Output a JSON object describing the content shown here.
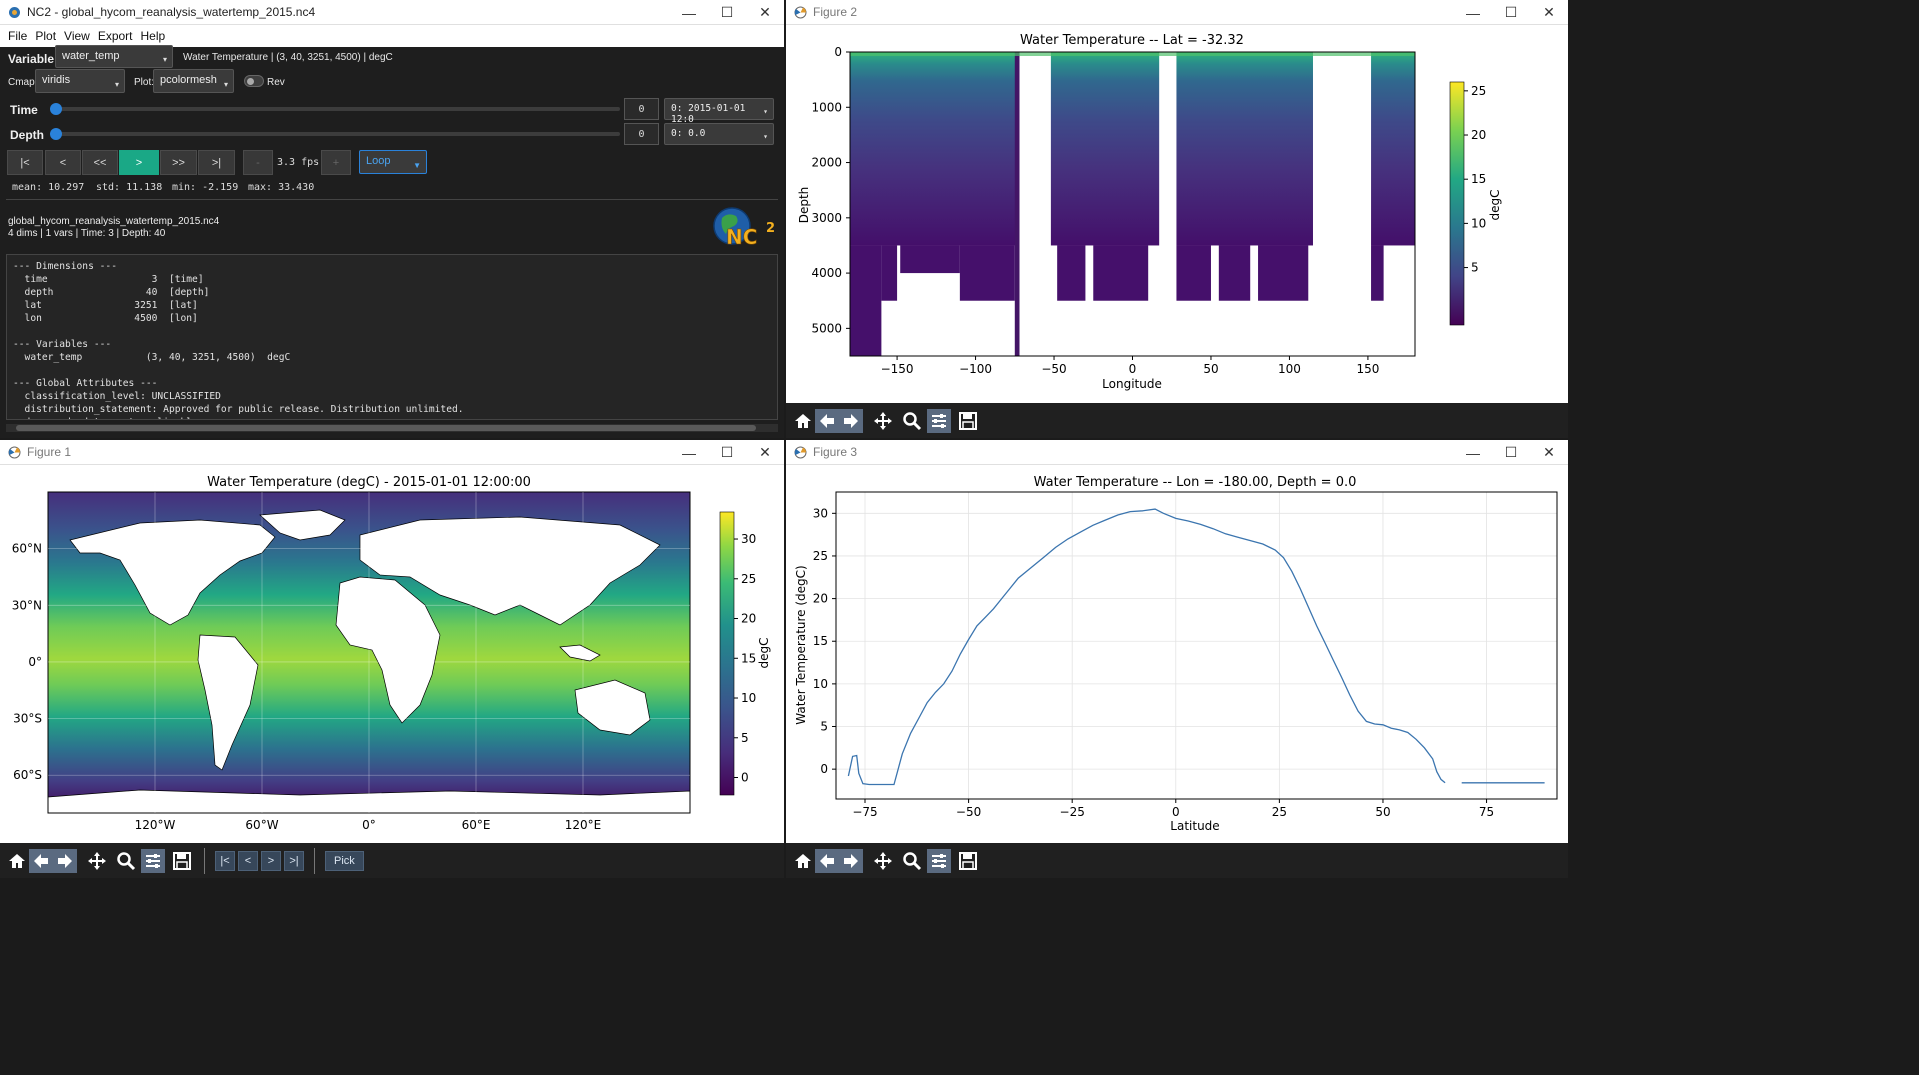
{
  "nc2": {
    "title": "NC2 - global_hycom_reanalysis_watertemp_2015.nc4",
    "menu": [
      "File",
      "Plot",
      "View",
      "Export",
      "Help"
    ],
    "variable_label": "Variable:",
    "variable_value": "water_temp",
    "variable_desc": "Water Temperature | (3, 40, 3251, 4500) | degC",
    "cmap_label": "Cmap:",
    "cmap_value": "viridis",
    "plot_label": "Plot:",
    "plot_value": "pcolormesh",
    "rev_label": "Rev",
    "time_label": "Time",
    "time_index": "0",
    "time_value": "0: 2015-01-01 12:0",
    "depth_label": "Depth",
    "depth_index": "0",
    "depth_value": "0: 0.0",
    "buttons": {
      "first": "|<",
      "prev": "<",
      "rew": "<<",
      "play": ">",
      "ff": ">>",
      "last": ">|",
      "minus": "-",
      "fps": "3.3 fps",
      "plus": "+",
      "loop": "Loop"
    },
    "stats": {
      "mean": "mean: 10.297",
      "std": "std: 11.138",
      "min": "min: -2.159",
      "max": "max: 33.430"
    },
    "file_name": "global_hycom_reanalysis_watertemp_2015.nc4",
    "file_summary": "4 dims | 1 vars | Time: 3 | Depth: 40",
    "logo_text": "NC",
    "info_text": "--- Dimensions ---\n  time                  3  [time]\n  depth                40  [depth]\n  lat                3251  [lat]\n  lon                4500  [lon]\n\n--- Variables ---\n  water_temp           (3, 40, 3251, 4500)  degC\n\n--- Global Attributes ---\n  classification_level: UNCLASSIFIED\n  distribution_statement: Approved for public release. Distribution unlimited.\n  downgrade_date: not applicable\n  classification_authority: not applicable\n  institution: Naval Oceanographic Office"
  },
  "fig1": {
    "title": "Figure 1",
    "plot_title": "Water Temperature (degC) - 2015-01-01 12:00:00",
    "xticks": [
      "120°W",
      "60°W",
      "0°",
      "60°E",
      "120°E"
    ],
    "yticks": [
      "60°N",
      "30°N",
      "0°",
      "30°S",
      "60°S"
    ],
    "cbar_ticks": [
      "30",
      "25",
      "20",
      "15",
      "10",
      "5",
      "0"
    ],
    "cbar_label": "degC",
    "nav_buttons": [
      "|<",
      "<",
      ">",
      ">|"
    ],
    "pick_label": "Pick"
  },
  "fig2": {
    "title": "Figure 2",
    "plot_title": "Water Temperature -- Lat = -32.32",
    "xlabel": "Longitude",
    "ylabel": "Depth",
    "xticks": [
      "−150",
      "−100",
      "−50",
      "0",
      "50",
      "100",
      "150"
    ],
    "yticks": [
      "0",
      "1000",
      "2000",
      "3000",
      "4000",
      "5000"
    ],
    "cbar_ticks": [
      "25",
      "20",
      "15",
      "10",
      "5"
    ],
    "cbar_label": "degC"
  },
  "fig3": {
    "title": "Figure 3",
    "plot_title": "Water Temperature -- Lon = -180.00, Depth = 0.0",
    "xlabel": "Latitude",
    "ylabel": "Water Temperature (degC)",
    "xticks": [
      "−75",
      "−50",
      "−25",
      "0",
      "25",
      "50",
      "75"
    ],
    "yticks": [
      "30",
      "25",
      "20",
      "15",
      "10",
      "5",
      "0"
    ]
  },
  "chart_data": [
    {
      "type": "line",
      "title": "Water Temperature -- Lon = -180.00, Depth = 0.0",
      "xlabel": "Latitude",
      "ylabel": "Water Temperature (degC)",
      "xlim": [
        -82,
        92
      ],
      "ylim": [
        -3.5,
        32.5
      ],
      "grid": true,
      "color": "#3b75af",
      "x": [
        -79,
        -78,
        -77,
        -76.5,
        -75.5,
        -74,
        -72,
        -70,
        -68,
        -66,
        -64,
        -62,
        -60,
        -58,
        -56,
        -54,
        -52,
        -50,
        -48,
        -46,
        -44,
        -42,
        -40,
        -38,
        -35,
        -32,
        -29,
        -26,
        -23,
        -20,
        -17,
        -14,
        -11,
        -8,
        -5,
        -3,
        0,
        3,
        6,
        9,
        12,
        15,
        18,
        21,
        24,
        26,
        28,
        30,
        32,
        34,
        36,
        38,
        40,
        42,
        44,
        46,
        48,
        50,
        52,
        54,
        56,
        58,
        60,
        62,
        63,
        64,
        65
      ],
      "y": [
        -0.8,
        1.5,
        1.6,
        -0.5,
        -1.7,
        -1.8,
        -1.8,
        -1.8,
        -1.8,
        1.8,
        4.2,
        6.0,
        7.8,
        9.0,
        10.0,
        11.5,
        13.5,
        15.2,
        16.8,
        17.8,
        18.8,
        20.0,
        21.2,
        22.4,
        23.6,
        24.8,
        26.0,
        27.0,
        27.8,
        28.6,
        29.2,
        29.8,
        30.2,
        30.3,
        30.5,
        30.0,
        29.4,
        29.1,
        28.7,
        28.2,
        27.6,
        27.2,
        26.8,
        26.4,
        25.7,
        24.8,
        23.2,
        21.2,
        19.0,
        16.8,
        14.8,
        12.8,
        10.8,
        8.7,
        6.8,
        5.6,
        5.3,
        5.2,
        4.8,
        4.6,
        4.3,
        3.5,
        2.5,
        1.2,
        -0.3,
        -1.2,
        -1.6
      ],
      "x2": [
        69,
        89
      ],
      "y2": [
        -1.6,
        -1.6
      ]
    },
    {
      "type": "heatmap",
      "title": "Water Temperature -- Lat = -32.32",
      "xlabel": "Longitude",
      "ylabel": "Depth",
      "xlim": [
        -180,
        180
      ],
      "ylim": [
        5500,
        0
      ],
      "colorbar_range": [
        -1.5,
        26
      ],
      "colorbar_label": "degC",
      "land_gaps_lon": [
        [
          -72,
          -52
        ],
        [
          17,
          28
        ],
        [
          115,
          152
        ]
      ]
    },
    {
      "type": "heatmap",
      "title": "Water Temperature (degC) - 2015-01-01 12:00:00",
      "xlim": [
        -180,
        180
      ],
      "ylim": [
        -80,
        90
      ],
      "colorbar_range": [
        -2.2,
        33.4
      ],
      "colorbar_label": "degC"
    }
  ]
}
